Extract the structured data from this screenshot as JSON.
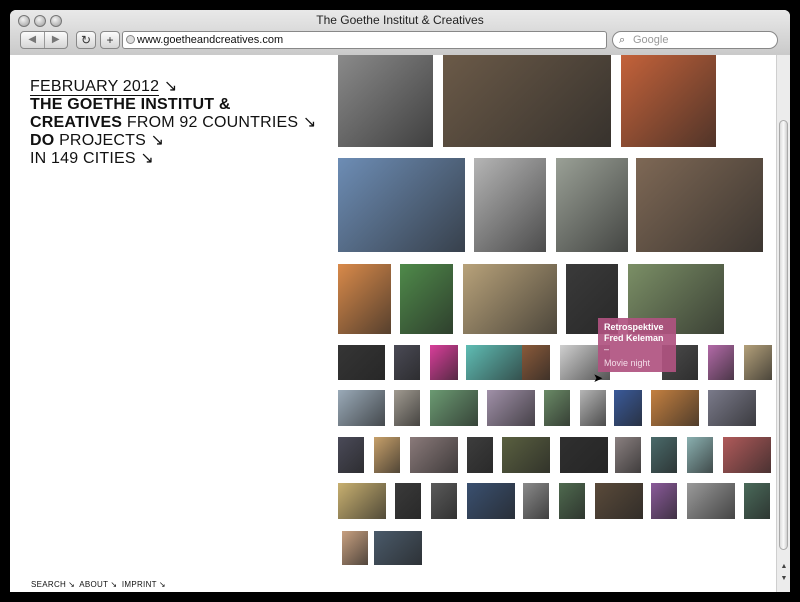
{
  "browser": {
    "window_title": "The Goethe Institut & Creatives",
    "url": "www.goetheandcreatives.com",
    "search_placeholder": "Google",
    "back_icon": "◀",
    "forward_icon": "▶",
    "reload_icon": "↻",
    "add_icon": "+"
  },
  "intro": {
    "date": "FEBRUARY 2012",
    "arrow": "↘",
    "line2": "THE GOETHE INSTITUT &",
    "line3_bold": "CREATIVES",
    "line3_rest": "FROM 92 COUNTRIES",
    "line4_bold": "DO",
    "line4_rest": "PROJECTS",
    "line5": "IN 149 CITIES"
  },
  "footer": {
    "search": "SEARCH",
    "about": "ABOUT",
    "imprint": "IMPRINT",
    "arrow": "↘"
  },
  "tooltip": {
    "title_line1": "Retrospektive",
    "title_line2": "Fred Keleman",
    "dash": "–",
    "subtitle": "Movie night"
  },
  "thumbnails": {
    "colors": [
      "#8a8a8a",
      "#6b5a48",
      "#c4623a",
      "#6d8db5",
      "#b5b5b5",
      "#9aa096",
      "#7e6855",
      "#d98a4a",
      "#4f8a4a",
      "#b8a27a",
      "#3a3a3a",
      "#7b8f66",
      "#353535",
      "#4a4a55",
      "#d93e9a",
      "#5fbdb4",
      "#8a5a3a",
      "#cfcfcf",
      "#4c4c4c",
      "#b36aa8",
      "#b3a07a",
      "#5a7a6a",
      "#9aaab8",
      "#a09a90",
      "#6b9a72",
      "#a090a8",
      "#6a8a66",
      "#b5b5b5",
      "#3a5a9a",
      "#c48040",
      "#7a7a8a",
      "#4a4a58",
      "#c7a06a",
      "#8a7a7a",
      "#3d3d3d",
      "#5a6040",
      "#2f2f2f",
      "#8a8080",
      "#4a6a6a",
      "#8ab0b0",
      "#b05a5a",
      "#c8b070",
      "#3a3a3a",
      "#5a5a5a",
      "#3a5070",
      "#8a8a8a",
      "#4f6a4f",
      "#5a4a3a",
      "#8a5a9a",
      "#9a9a9a",
      "#4a6a5a",
      "#c8a080",
      "#4a5a6a"
    ]
  }
}
